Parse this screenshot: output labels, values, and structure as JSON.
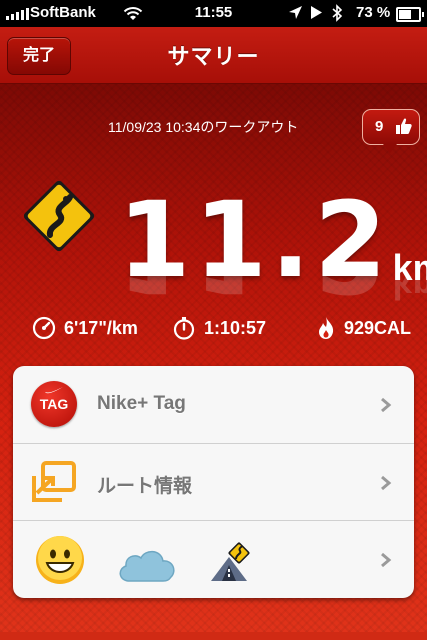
{
  "status_bar": {
    "carrier": "SoftBank",
    "time": "11:55",
    "battery": "73 %",
    "battery_level": 0.73
  },
  "nav": {
    "done_label": "完了",
    "title": "サマリー"
  },
  "workout": {
    "datetime_label": "11/09/23 10:34のワークアウト",
    "likes_count": "9",
    "distance": "11.2",
    "distance_unit": "km",
    "pace": "6'17\"/km",
    "duration": "1:10:57",
    "calories": "929CAL"
  },
  "menu": {
    "items": [
      {
        "label": "Nike+ Tag",
        "icon": "nike-tag-icon",
        "icon_text": "TAG"
      },
      {
        "label": "ルート情報",
        "icon": "route-icon"
      },
      {
        "label": "",
        "icons": [
          "smiley-face-icon",
          "cloud-icon",
          "terrain-road-icon"
        ]
      }
    ]
  },
  "colors": {
    "nike_red": "#c41d12",
    "status_bar": "#000000",
    "card_bg": "#f7f7f7",
    "route_orange": "#f5a623"
  }
}
